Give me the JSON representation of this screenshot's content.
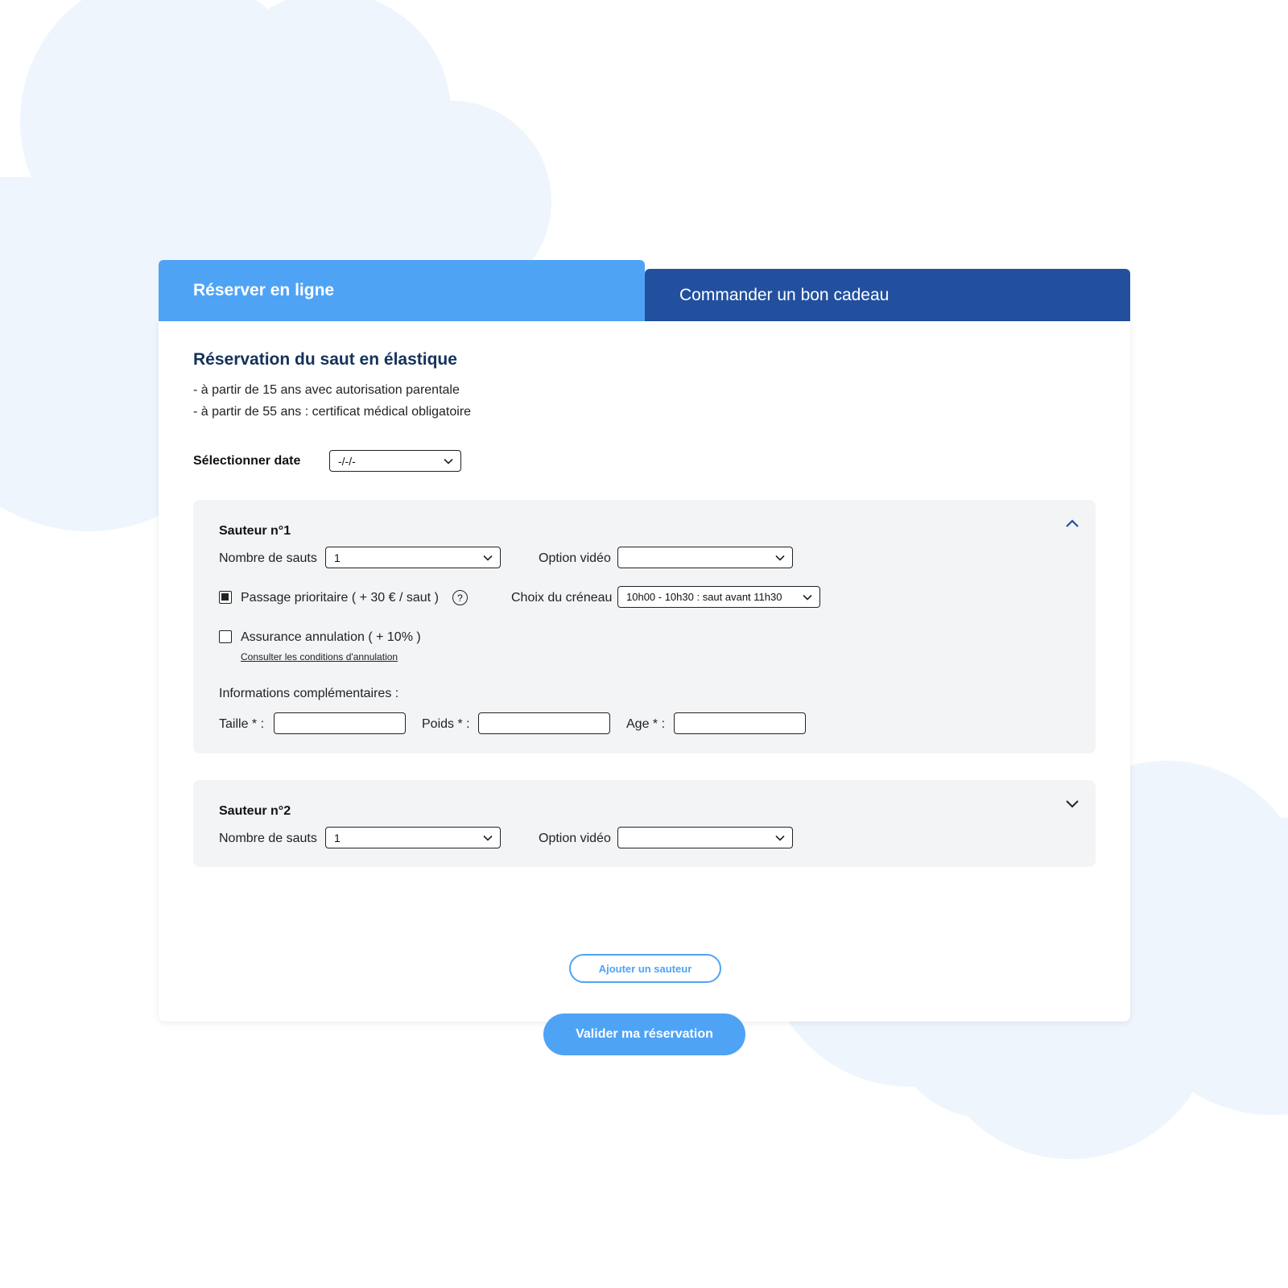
{
  "tabs": {
    "active": "Réserver en ligne",
    "inactive": "Commander un bon cadeau"
  },
  "form": {
    "title": "Réservation du saut en élastique",
    "notes": [
      "- à partir de 15 ans avec autorisation parentale",
      "- à partir de 55 ans : certificat médical obligatoire"
    ],
    "date_label": "Sélectionner date",
    "date_value": "-/-/-"
  },
  "jumper1": {
    "title": "Sauteur n°1",
    "jumps_label": "Nombre de sauts",
    "jumps_value": "1",
    "video_label": "Option vidéo",
    "video_value": "",
    "priority_label": "Passage prioritaire ( + 30 € / saut )",
    "priority_checked": true,
    "help_symbol": "?",
    "slot_label": "Choix du créneau",
    "slot_value": "10h00 - 10h30 : saut avant 11h30",
    "insurance_label": "Assurance annulation ( + 10% )",
    "insurance_checked": false,
    "conditions_link": "Consulter les conditions d'annulation",
    "info_label": "Informations complémentaires :",
    "height_label": "Taille * :",
    "weight_label": "Poids * :",
    "age_label": "Age * :"
  },
  "jumper2": {
    "title": "Sauteur n°2",
    "jumps_label": "Nombre de sauts",
    "jumps_value": "1",
    "video_label": "Option vidéo",
    "video_value": ""
  },
  "actions": {
    "add_jumper": "Ajouter un sauteur",
    "submit": "Valider ma réservation"
  },
  "colors": {
    "primary": "#4fa3f5",
    "dark_blue": "#22509e",
    "title_navy": "#14325a",
    "cloud": "#eef5fd",
    "section_bg": "#f3f4f6"
  }
}
